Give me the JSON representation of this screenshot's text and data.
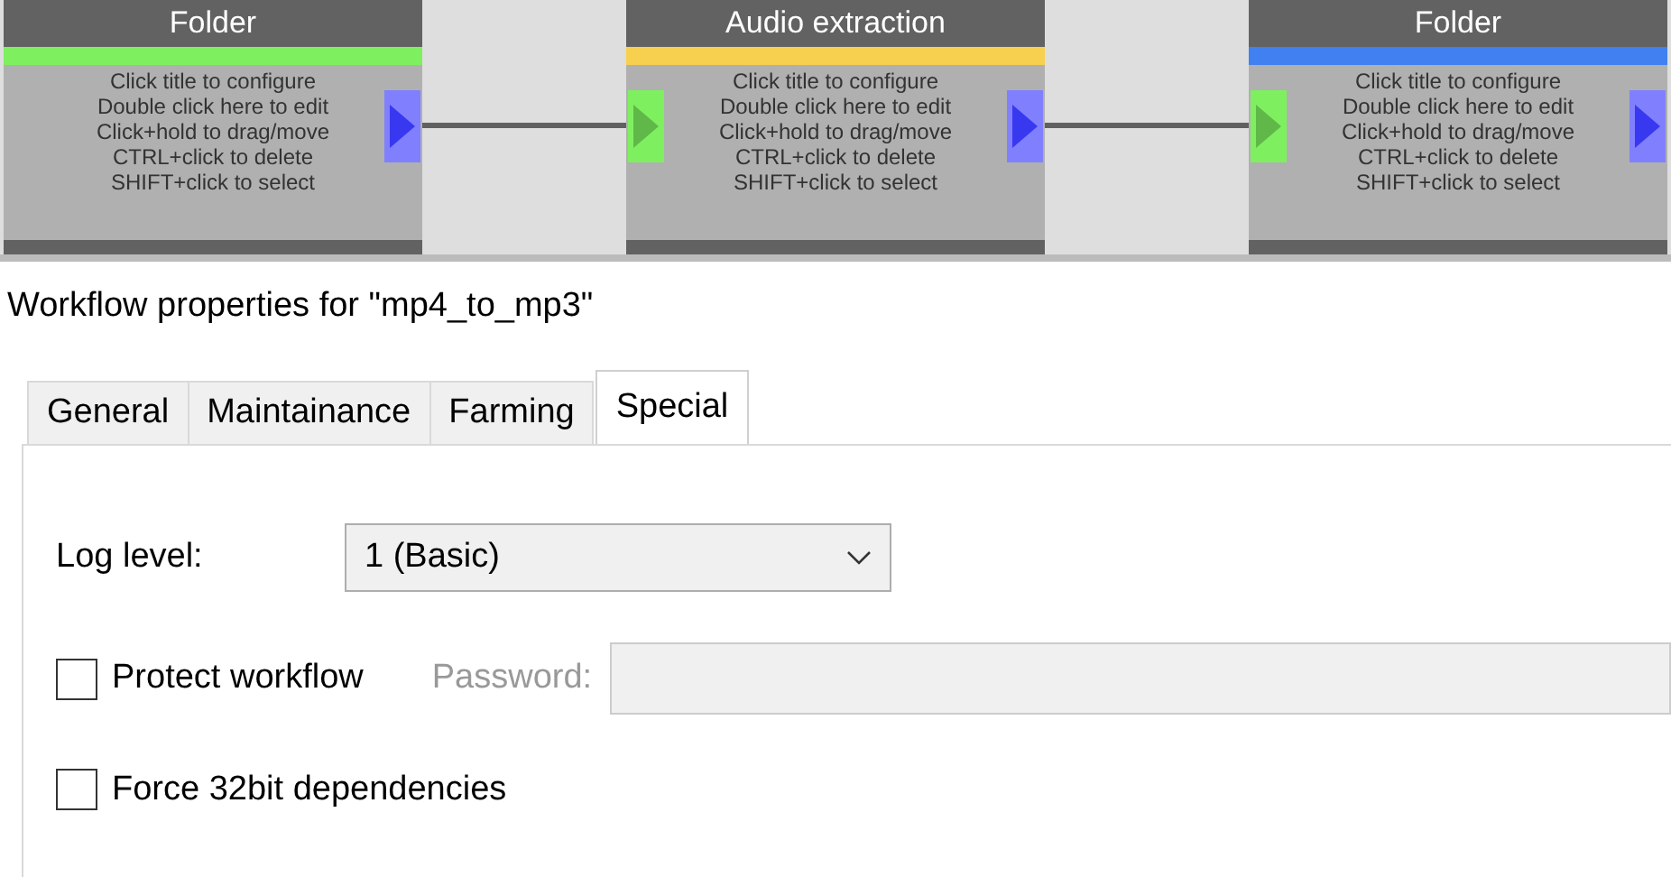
{
  "nodes": [
    {
      "title": "Folder",
      "color": "#7ef060",
      "input_port": false,
      "output_port": true,
      "hints": [
        "Click title to configure",
        "Double click here to edit",
        "Click+hold to drag/move",
        "CTRL+click to delete",
        "SHIFT+click to select"
      ]
    },
    {
      "title": "Audio extraction",
      "color": "#f8d050",
      "input_port": true,
      "output_port": true,
      "hints": [
        "Click title to configure",
        "Double click here to edit",
        "Click+hold to drag/move",
        "CTRL+click to delete",
        "SHIFT+click to select"
      ]
    },
    {
      "title": "Folder",
      "color": "#4080f0",
      "input_port": true,
      "output_port": true,
      "hints": [
        "Click title to configure",
        "Double click here to edit",
        "Click+hold to drag/move",
        "CTRL+click to delete",
        "SHIFT+click to select"
      ]
    }
  ],
  "properties_title": "Workflow properties for \"mp4_to_mp3\"",
  "tabs": [
    {
      "label": "General",
      "selected": false
    },
    {
      "label": "Maintainance",
      "selected": false
    },
    {
      "label": "Farming",
      "selected": false
    },
    {
      "label": "Special",
      "selected": true
    }
  ],
  "log_level": {
    "label": "Log level:",
    "value": "1 (Basic)"
  },
  "protect": {
    "label": "Protect workflow",
    "checked": false,
    "password_label": "Password:",
    "password_disabled": true
  },
  "force32": {
    "label": "Force 32bit dependencies",
    "checked": false
  }
}
